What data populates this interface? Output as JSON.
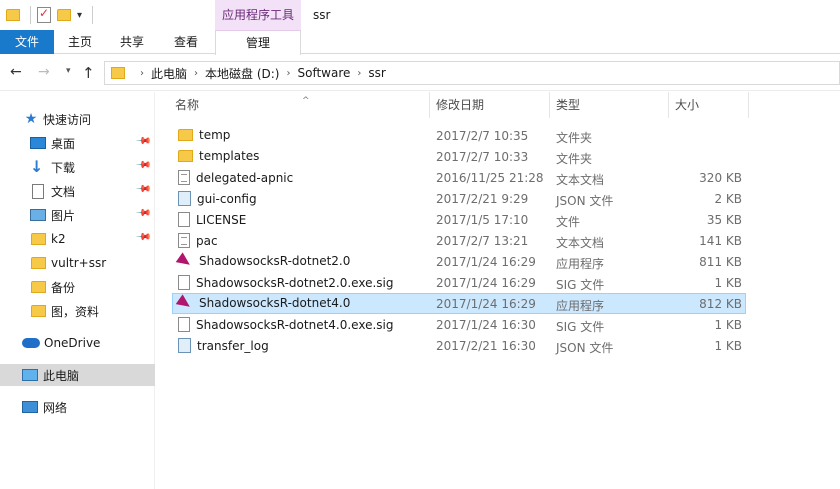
{
  "titlebar": {
    "context_tab_header": "应用程序工具",
    "window_title": "ssr"
  },
  "ribbon": {
    "tabs": [
      "文件",
      "主页",
      "共享",
      "查看",
      "管理"
    ]
  },
  "address": {
    "crumbs": [
      "此电脑",
      "本地磁盘 (D:)",
      "Software",
      "ssr"
    ]
  },
  "nav": {
    "quick_access": "快速访问",
    "items": [
      {
        "label": "桌面",
        "icon": "desktop-icon",
        "pinned": true
      },
      {
        "label": "下载",
        "icon": "download-icon",
        "pinned": true
      },
      {
        "label": "文档",
        "icon": "documents-icon",
        "pinned": true
      },
      {
        "label": "图片",
        "icon": "pictures-icon",
        "pinned": true
      },
      {
        "label": "k2",
        "icon": "folder-icon",
        "pinned": true
      },
      {
        "label": "vultr+ssr",
        "icon": "folder-icon",
        "pinned": false
      },
      {
        "label": "备份",
        "icon": "folder-icon",
        "pinned": false
      },
      {
        "label": "图，资料",
        "icon": "folder-icon",
        "pinned": false
      }
    ],
    "onedrive": "OneDrive",
    "this_pc": "此电脑",
    "network": "网络"
  },
  "columns": {
    "name": "名称",
    "date": "修改日期",
    "type": "类型",
    "size": "大小"
  },
  "files": [
    {
      "name": "temp",
      "date": "2017/2/7 10:35",
      "type": "文件夹",
      "size": "",
      "icon": "folder"
    },
    {
      "name": "templates",
      "date": "2017/2/7 10:33",
      "type": "文件夹",
      "size": "",
      "icon": "folder"
    },
    {
      "name": "delegated-apnic",
      "date": "2016/11/25 21:28",
      "type": "文本文档",
      "size": "320 KB",
      "icon": "text"
    },
    {
      "name": "gui-config",
      "date": "2017/2/21 9:29",
      "type": "JSON 文件",
      "size": "2 KB",
      "icon": "json"
    },
    {
      "name": "LICENSE",
      "date": "2017/1/5 17:10",
      "type": "文件",
      "size": "35 KB",
      "icon": "blank"
    },
    {
      "name": "pac",
      "date": "2017/2/7 13:21",
      "type": "文本文档",
      "size": "141 KB",
      "icon": "text"
    },
    {
      "name": "ShadowsocksR-dotnet2.0",
      "date": "2017/1/24 16:29",
      "type": "应用程序",
      "size": "811 KB",
      "icon": "app"
    },
    {
      "name": "ShadowsocksR-dotnet2.0.exe.sig",
      "date": "2017/1/24 16:29",
      "type": "SIG 文件",
      "size": "1 KB",
      "icon": "blank"
    },
    {
      "name": "ShadowsocksR-dotnet4.0",
      "date": "2017/1/24 16:29",
      "type": "应用程序",
      "size": "812 KB",
      "icon": "app",
      "selected": true
    },
    {
      "name": "ShadowsocksR-dotnet4.0.exe.sig",
      "date": "2017/1/24 16:30",
      "type": "SIG 文件",
      "size": "1 KB",
      "icon": "blank"
    },
    {
      "name": "transfer_log",
      "date": "2017/2/21 16:30",
      "type": "JSON 文件",
      "size": "1 KB",
      "icon": "json"
    }
  ],
  "colors": {
    "file_tab": "#1979ca",
    "context_tab": "#f3e2f7",
    "selection": "#cce8ff",
    "selection_border": "#99d1ff",
    "folder": "#f7c948"
  }
}
